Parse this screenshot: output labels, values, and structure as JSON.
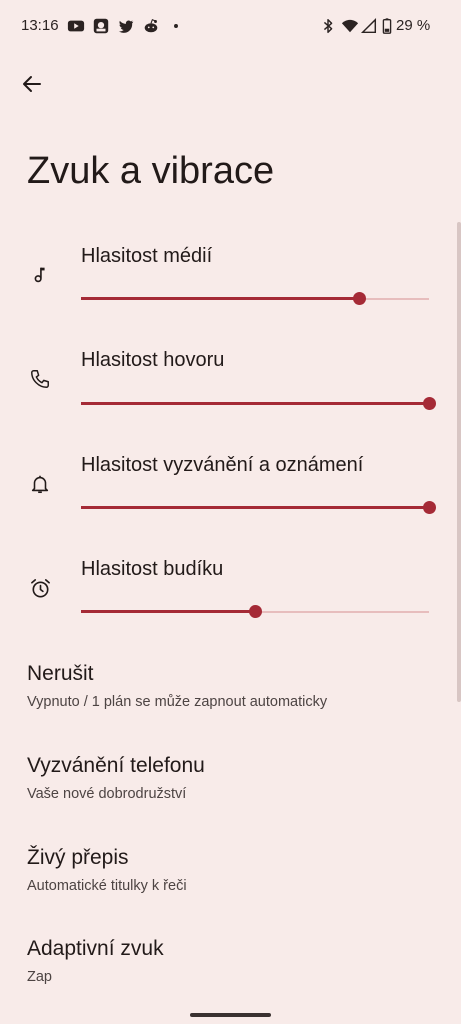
{
  "status_bar": {
    "time": "13:16",
    "battery": "29 %",
    "icons": [
      "youtube-icon",
      "app-icon",
      "twitter-icon",
      "reddit-icon",
      "notification-dot-icon",
      "bluetooth-icon",
      "wifi-icon",
      "signal-icon",
      "battery-icon"
    ]
  },
  "header": {
    "title": "Zvuk a vibrace"
  },
  "volumes": [
    {
      "label": "Hlasitost médií",
      "icon": "music-note-icon",
      "level": 0.8
    },
    {
      "label": "Hlasitost hovoru",
      "icon": "phone-icon",
      "level": 1.0
    },
    {
      "label": "Hlasitost vyzvánění a oznámení",
      "icon": "bell-icon",
      "level": 1.0
    },
    {
      "label": "Hlasitost budíku",
      "icon": "alarm-clock-icon",
      "level": 0.5
    }
  ],
  "settings": [
    {
      "title": "Nerušit",
      "subtitle": "Vypnuto / 1 plán se může zapnout automaticky"
    },
    {
      "title": "Vyzvánění telefonu",
      "subtitle": "Vaše nové dobrodružství"
    },
    {
      "title": "Živý přepis",
      "subtitle": "Automatické titulky k řeči"
    },
    {
      "title": "Adaptivní zvuk",
      "subtitle": "Zap"
    }
  ],
  "colors": {
    "background": "#f8ebe9",
    "accent": "#a52a36",
    "track_inactive": "#e7bdbd"
  }
}
